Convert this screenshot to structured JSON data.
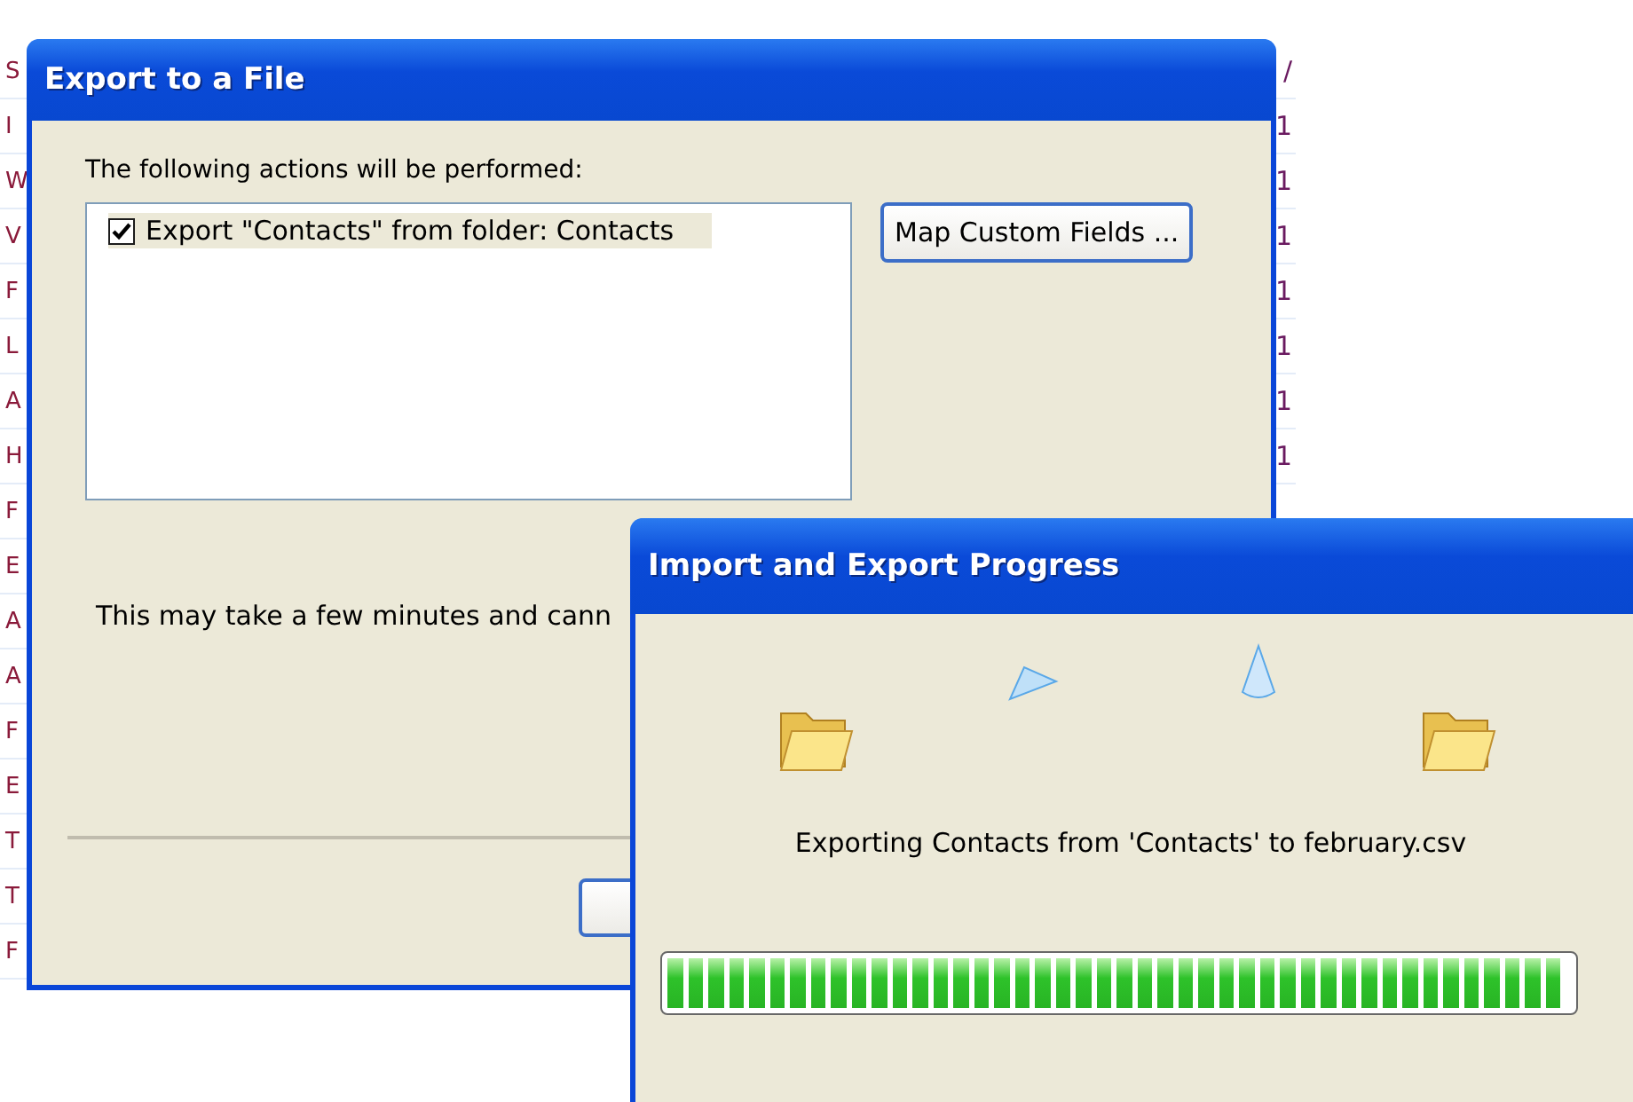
{
  "background_list": {
    "rows": [
      {
        "initial": "S",
        "date": "/"
      },
      {
        "initial": "I",
        "date": "1"
      },
      {
        "initial": "W",
        "date": "1"
      },
      {
        "initial": "V",
        "date": "1"
      },
      {
        "initial": "F",
        "date": "1"
      },
      {
        "initial": "L",
        "date": "1"
      },
      {
        "initial": "A",
        "date": "1"
      },
      {
        "initial": "H",
        "date": "1"
      },
      {
        "initial": "F"
      },
      {
        "initial": "E"
      },
      {
        "initial": "A"
      },
      {
        "initial": "A"
      },
      {
        "initial": "F"
      },
      {
        "initial": "E"
      },
      {
        "initial": "T"
      },
      {
        "initial": "T"
      },
      {
        "initial": "F"
      }
    ]
  },
  "export_dialog": {
    "title": "Export to a File",
    "intro": "The following actions will be performed:",
    "actions": [
      {
        "label": "Export \"Contacts\" from folder: Contacts",
        "checked": true,
        "selected": true
      }
    ],
    "map_button": "Map Custom Fields ...",
    "note": "This may take a few minutes and cann"
  },
  "progress_dialog": {
    "title": "Import and Export Progress",
    "status": "Exporting Contacts from 'Contacts' to february.csv",
    "level": 1
  }
}
